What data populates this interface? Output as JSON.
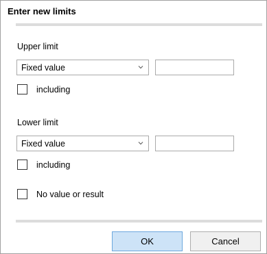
{
  "dialog": {
    "title": "Enter new limits"
  },
  "upper": {
    "label": "Upper limit",
    "mode": "Fixed value",
    "value": "",
    "including_label": "including",
    "including_checked": false
  },
  "lower": {
    "label": "Lower limit",
    "mode": "Fixed value",
    "value": "",
    "including_label": "including",
    "including_checked": false
  },
  "no_value": {
    "label": "No value or result",
    "checked": false
  },
  "buttons": {
    "ok_label": "OK",
    "cancel_label": "Cancel"
  },
  "colors": {
    "ok_background": "#cde3f7",
    "ok_border": "#6ba7dd",
    "divider": "#dcdcdc"
  },
  "icons": {
    "dropdown": "chevron-down-icon"
  }
}
